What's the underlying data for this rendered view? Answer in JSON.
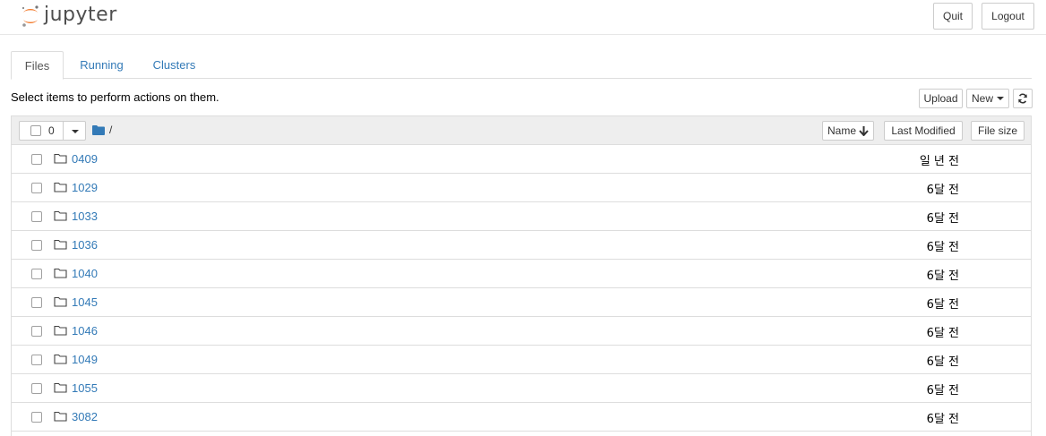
{
  "header": {
    "logo_text": "jupyter",
    "quit_label": "Quit",
    "logout_label": "Logout"
  },
  "tabs": [
    {
      "label": "Files",
      "active": true
    },
    {
      "label": "Running",
      "active": false
    },
    {
      "label": "Clusters",
      "active": false
    }
  ],
  "toolbar": {
    "hint": "Select items to perform actions on them.",
    "upload_label": "Upload",
    "new_label": "New",
    "refresh_icon": "refresh-icon"
  },
  "list_header": {
    "selected_count": "0",
    "breadcrumb": "/",
    "sort_name_label": "Name",
    "last_modified_label": "Last Modified",
    "file_size_label": "File size"
  },
  "colors": {
    "link": "#337ab7",
    "logo_orange": "#f37726",
    "header_bg": "#eeeeee"
  },
  "files": [
    {
      "name": "0409",
      "modified": "일 년 전"
    },
    {
      "name": "1029",
      "modified": "6달 전"
    },
    {
      "name": "1033",
      "modified": "6달 전"
    },
    {
      "name": "1036",
      "modified": "6달 전"
    },
    {
      "name": "1040",
      "modified": "6달 전"
    },
    {
      "name": "1045",
      "modified": "6달 전"
    },
    {
      "name": "1046",
      "modified": "6달 전"
    },
    {
      "name": "1049",
      "modified": "6달 전"
    },
    {
      "name": "1055",
      "modified": "6달 전"
    },
    {
      "name": "3082",
      "modified": "6달 전"
    }
  ]
}
